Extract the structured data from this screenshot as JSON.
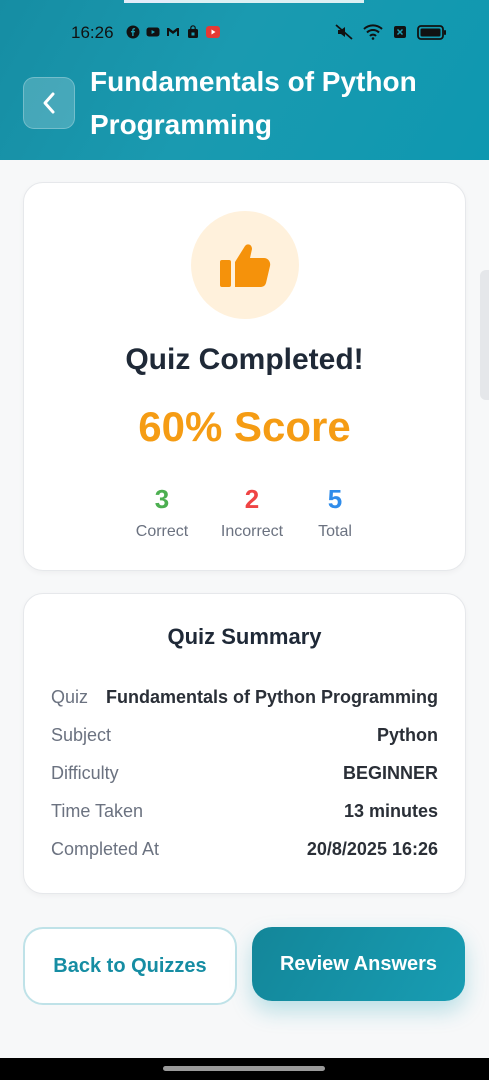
{
  "status_bar": {
    "time": "16:26",
    "left_icons": [
      "facebook-icon",
      "youtube-icon",
      "gmail-icon",
      "shopping-bag-icon",
      "youtube-red-icon"
    ],
    "right_icons": [
      "mute-icon",
      "wifi-icon",
      "sim-off-icon",
      "battery-icon"
    ]
  },
  "header": {
    "title": "Fundamentals of Python Programming",
    "back_icon": "chevron-left-icon"
  },
  "result": {
    "icon": "thumbs-up-icon",
    "title": "Quiz Completed!",
    "score_label": "60% Score",
    "stats": [
      {
        "value": "3",
        "label": "Correct",
        "color": "#4caf50"
      },
      {
        "value": "2",
        "label": "Incorrect",
        "color": "#ef4444"
      },
      {
        "value": "5",
        "label": "Total",
        "color": "#2f8cea"
      }
    ]
  },
  "summary": {
    "title": "Quiz Summary",
    "rows": [
      {
        "label": "Quiz",
        "value": "Fundamentals of Python Programming"
      },
      {
        "label": "Subject",
        "value": "Python"
      },
      {
        "label": "Difficulty",
        "value": "BEGINNER"
      },
      {
        "label": "Time Taken",
        "value": "13 minutes"
      },
      {
        "label": "Completed At",
        "value": "20/8/2025 16:26"
      }
    ]
  },
  "actions": {
    "back_label": "Back to Quizzes",
    "review_label": "Review Answers"
  },
  "colors": {
    "accent": "#168da3",
    "score": "#f59c14",
    "correct": "#4caf50",
    "incorrect": "#ef4444",
    "total": "#2f8cea"
  }
}
